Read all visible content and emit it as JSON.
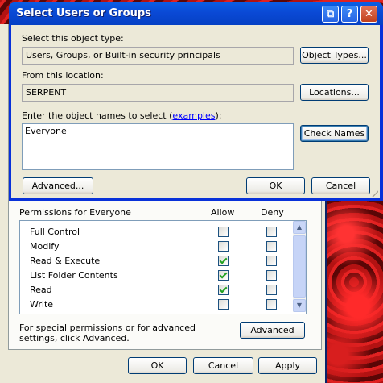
{
  "dialog": {
    "title": "Select Users or Groups",
    "object_type_label": "Select this object type:",
    "object_type_value": "Users, Groups, or Built-in security principals",
    "object_types_button": "Object Types...",
    "location_label": "From this location:",
    "location_value": "SERPENT",
    "locations_button": "Locations...",
    "names_label_prefix": "Enter the object names to select (",
    "names_label_link": "examples",
    "names_label_suffix": "):",
    "names_value": "Everyone",
    "check_names_button": "Check Names",
    "advanced_button": "Advanced...",
    "ok_button": "OK",
    "cancel_button": "Cancel"
  },
  "back_window": {
    "permissions_header": "Permissions for Everyone",
    "allow_header": "Allow",
    "deny_header": "Deny",
    "permissions": [
      {
        "label": "Full Control",
        "allow": false,
        "deny": false
      },
      {
        "label": "Modify",
        "allow": false,
        "deny": false
      },
      {
        "label": "Read & Execute",
        "allow": true,
        "deny": false
      },
      {
        "label": "List Folder Contents",
        "allow": true,
        "deny": false
      },
      {
        "label": "Read",
        "allow": true,
        "deny": false
      },
      {
        "label": "Write",
        "allow": false,
        "deny": false
      }
    ],
    "special_note": "For special permissions or for advanced settings, click Advanced.",
    "advanced_button": "Advanced",
    "ok_button": "OK",
    "cancel_button": "Cancel",
    "apply_button": "Apply"
  },
  "colors": {
    "titlebar": "#0a49d5",
    "dialog_bg": "#ece9d8",
    "check_green": "#21a121"
  }
}
